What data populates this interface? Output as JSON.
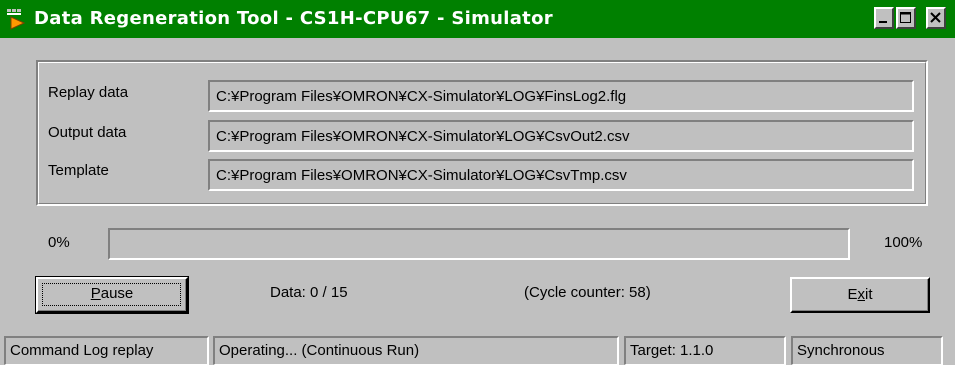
{
  "window": {
    "title": "Data Regeneration Tool - CS1H-CPU67 - Simulator",
    "title_bar_color": "#008000",
    "controls": [
      "minimize-icon",
      "maximize-icon",
      "close-icon"
    ]
  },
  "files": {
    "replay": {
      "label": "Replay data",
      "value": "C:¥Program Files¥OMRON¥CX-Simulator¥LOG¥FinsLog2.flg"
    },
    "output": {
      "label": "Output data",
      "value": "C:¥Program Files¥OMRON¥CX-Simulator¥LOG¥CsvOut2.csv"
    },
    "template": {
      "label": "Template",
      "value": "C:¥Program Files¥OMRON¥CX-Simulator¥LOG¥CsvTmp.csv"
    }
  },
  "progress": {
    "min_label": "0%",
    "max_label": "100%",
    "value_percent": 0
  },
  "controls": {
    "pause_prefix": "",
    "pause_mnemonic": "P",
    "pause_rest": "ause",
    "data_count": "Data: 0 / 15",
    "cycle_counter": "(Cycle counter: 58)",
    "exit_prefix": "E",
    "exit_mnemonic": "x",
    "exit_rest": "it"
  },
  "status": {
    "mode": "Command Log replay",
    "state": "Operating... (Continuous Run)",
    "target": "Target: 1.1.0",
    "sync": "Synchronous"
  }
}
